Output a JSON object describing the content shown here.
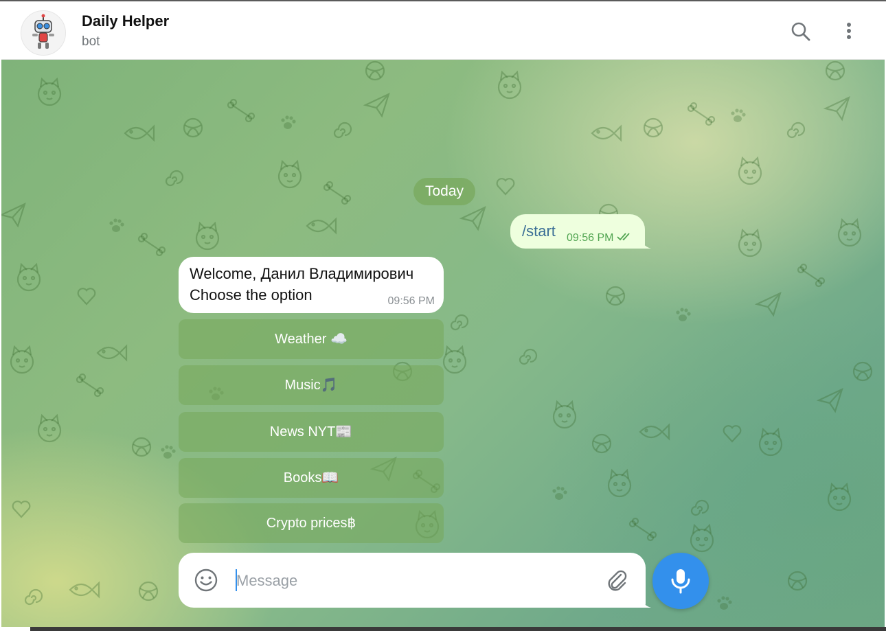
{
  "header": {
    "title": "Daily Helper",
    "subtitle": "bot"
  },
  "chat": {
    "date_pill": "Today",
    "outgoing": {
      "text": "/start",
      "time": "09:56 PM"
    },
    "incoming": {
      "line1": "Welcome, Данил Владимирович",
      "line2": "Choose the option",
      "time": "09:56 PM"
    },
    "keyboard_buttons": [
      "Weather ☁️",
      "Music🎵",
      "News NYT📰",
      "Books📖",
      "Crypto prices฿"
    ]
  },
  "composer": {
    "placeholder": "Message"
  },
  "icons": {
    "search": "search-icon",
    "menu": "more-vertical-icon",
    "emoji": "smile-icon",
    "attach": "paperclip-icon",
    "mic": "microphone-icon"
  },
  "colors": {
    "accent": "#3390ec",
    "outgoing_bubble": "#eeffde",
    "read_check": "#52a552"
  }
}
